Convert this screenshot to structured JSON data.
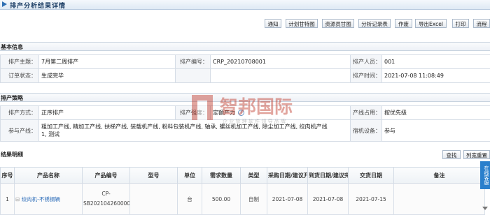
{
  "title": "排产分析结果详情",
  "toolbar": [
    "通知",
    "计划甘特图",
    "资源员甘图",
    "分析记录表",
    "作废",
    "导出Excel",
    "打印",
    "流程"
  ],
  "basic_section": "基本信息",
  "basic": {
    "theme_label": "排产主题：",
    "theme_value": "7月第二周排产",
    "number_label": "排产编号：",
    "number_value": "CRP_20210708001",
    "person_label": "排产人员：",
    "person_value": "001",
    "status_label": "订单状态：",
    "status_value": "生成完毕",
    "time_label": "排产时间：",
    "time_value": "2021-07-08 11:08:49"
  },
  "strategy_section": "排产策略",
  "strategy": {
    "method_label": "排产方式：",
    "method_value": "正序排产",
    "strength_label": "排产强度：",
    "strength_value": "定额产力",
    "line_label": "产线占用：",
    "line_value": "按优先级",
    "participate_label": "参与产线：",
    "participate_value1": "粗加工产线, 精加工产线, 扶梯产线, 装载机产线, 粉料包装机产线, 轴承, 螺丝机加工产线, 除尘加工产线, 绞肉机产线",
    "participate_value2": "1, 测试",
    "equip_label": "宿机设备：",
    "equip_value": "参与"
  },
  "result_section": "结果明细",
  "result_buttons": [
    "查找",
    "列宽重置"
  ],
  "watermark": {
    "brand": "智邦国际",
    "sub": "企 业 管 理 软 件 领 导 品 牌"
  },
  "side_tab": "在线客服",
  "table": {
    "headers": [
      "序号",
      "产品名称",
      "产品编号",
      "型号",
      "单位",
      "需求数量",
      "类型",
      "采购日期/建议开",
      "到货日期/建议完",
      "交货日期",
      "备注"
    ],
    "row": {
      "index": "1",
      "name": "绞肉机-不锈钢辆",
      "code1": "CP-",
      "code2": "SB2021042600001",
      "model": "",
      "unit": "台",
      "qty": "500.00",
      "type": "自制",
      "purchase": "2021-07-08",
      "arrival": "2021-07-08",
      "delivery": "2021-07-15",
      "note": ""
    }
  },
  "colors": {
    "accent": "#2f6fb3",
    "link": "#2a6bb8",
    "watermark": "#c0392b"
  }
}
